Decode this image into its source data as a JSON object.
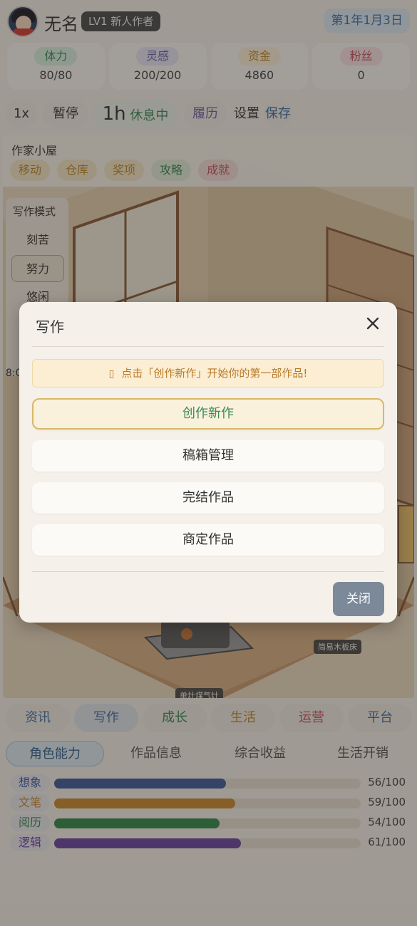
{
  "player": {
    "name": "无名",
    "level": "LV1 新人作者",
    "date": "第1年1月3日"
  },
  "stats": [
    {
      "label": "体力",
      "value": "80/80",
      "bg": "#d9f0de",
      "fg": "#3a8a55"
    },
    {
      "label": "灵感",
      "value": "200/200",
      "bg": "#e7e4f4",
      "fg": "#6b60a8"
    },
    {
      "label": "资金",
      "value": "4860",
      "bg": "#fbf0d6",
      "fg": "#c0892a"
    },
    {
      "label": "粉丝",
      "value": "0",
      "bg": "#f8e0e2",
      "fg": "#c45060"
    }
  ],
  "controls": {
    "speed": "1x",
    "pause": "暂停",
    "hours": "1h",
    "status": "休息中",
    "resume": "履历",
    "settings": "设置",
    "save": "保存"
  },
  "scene": {
    "title": "作家小屋",
    "tabs": [
      {
        "label": "移动",
        "fg": "#b8892f",
        "bg": "#f5e6c6"
      },
      {
        "label": "仓库",
        "fg": "#c0892a",
        "bg": "#f5e6c6"
      },
      {
        "label": "奖项",
        "fg": "#c0892a",
        "bg": "#f5e6c6"
      },
      {
        "label": "攻略",
        "fg": "#3a8a55",
        "bg": "#e2ecd8"
      },
      {
        "label": "成就",
        "fg": "#c45060",
        "bg": "#f5dcd8"
      }
    ],
    "writing_mode": {
      "title": "写作模式",
      "options": [
        "刻苦",
        "努力",
        "悠闲"
      ]
    },
    "time": "8:0",
    "bed_label": "简易木板床",
    "bottom_label": "单灶煤气灶"
  },
  "bottom_nav": [
    {
      "label": "资讯",
      "color": "#3f6ea8"
    },
    {
      "label": "写作",
      "color": "#3f6ea8"
    },
    {
      "label": "成长",
      "color": "#3a8a55"
    },
    {
      "label": "生活",
      "color": "#c0892a"
    },
    {
      "label": "运营",
      "color": "#c45060"
    },
    {
      "label": "平台",
      "color": "#3f6ea8"
    }
  ],
  "subtabs": [
    "角色能力",
    "作品信息",
    "综合收益",
    "生活开销"
  ],
  "abilities": [
    {
      "label": "想象",
      "value": "56/100",
      "level": 0.56,
      "color": "#3e5a99",
      "fg": "#3e5a99"
    },
    {
      "label": "文笔",
      "value": "59/100",
      "level": 0.59,
      "color": "#c98a2e",
      "fg": "#c98a2e"
    },
    {
      "label": "阅历",
      "value": "54/100",
      "level": 0.54,
      "color": "#2f8a4a",
      "fg": "#2f8a4a"
    },
    {
      "label": "逻辑",
      "value": "61/100",
      "level": 0.61,
      "color": "#6a44a0",
      "fg": "#6a44a0"
    }
  ],
  "modal": {
    "title": "写作",
    "hint": "点击「创作新作」开始你的第一部作品!",
    "buttons": [
      "创作新作",
      "稿箱管理",
      "完结作品",
      "商定作品"
    ],
    "close": "关闭"
  }
}
